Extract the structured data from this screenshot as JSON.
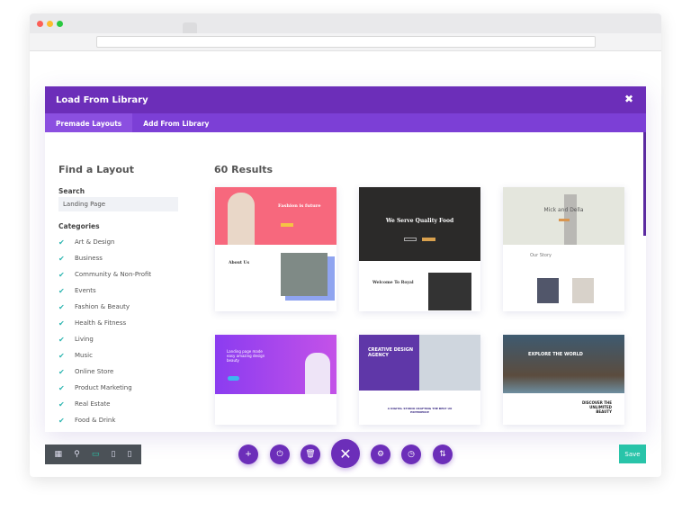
{
  "modal": {
    "title": "Load From Library",
    "close_icon": "close-icon",
    "tabs": [
      {
        "label": "Premade Layouts",
        "active": true
      },
      {
        "label": "Add From Library",
        "active": false
      }
    ]
  },
  "sidebar": {
    "heading": "Find a Layout",
    "search_label": "Search",
    "search_value": "Landing Page",
    "categories_label": "Categories",
    "categories": [
      "Art & Design",
      "Business",
      "Community & Non-Profit",
      "Events",
      "Fashion & Beauty",
      "Health & Fitness",
      "Living",
      "Music",
      "Online Store",
      "Product Marketing",
      "Real Estate",
      "Food & Drink"
    ]
  },
  "results": {
    "count_label": "60 Results",
    "cards": [
      {
        "hero": "Fashion is future",
        "section": "About Us"
      },
      {
        "hero": "We Serve Quality Food",
        "section": "Welcome To Royal"
      },
      {
        "hero": "Mick and Della",
        "section": "Our Story"
      },
      {
        "hero": "Landing page made easy amazing design beauty",
        "section": ""
      },
      {
        "hero": "CREATIVE DESIGN AGENCY",
        "section": "A DIGITAL STUDIO CRAFTING THE BEST UX EXPERIENCE"
      },
      {
        "hero": "EXPLORE THE WORLD",
        "section": "DISCOVER THE UNLIMITED BEAUTY"
      }
    ]
  },
  "toolbar": {
    "save_label": "Save",
    "close_symbol": "✕"
  },
  "colors": {
    "primary": "#6c2eb9",
    "tabs": "#7c3fd6",
    "save": "#29c4a9",
    "check": "#2cb5b0"
  }
}
